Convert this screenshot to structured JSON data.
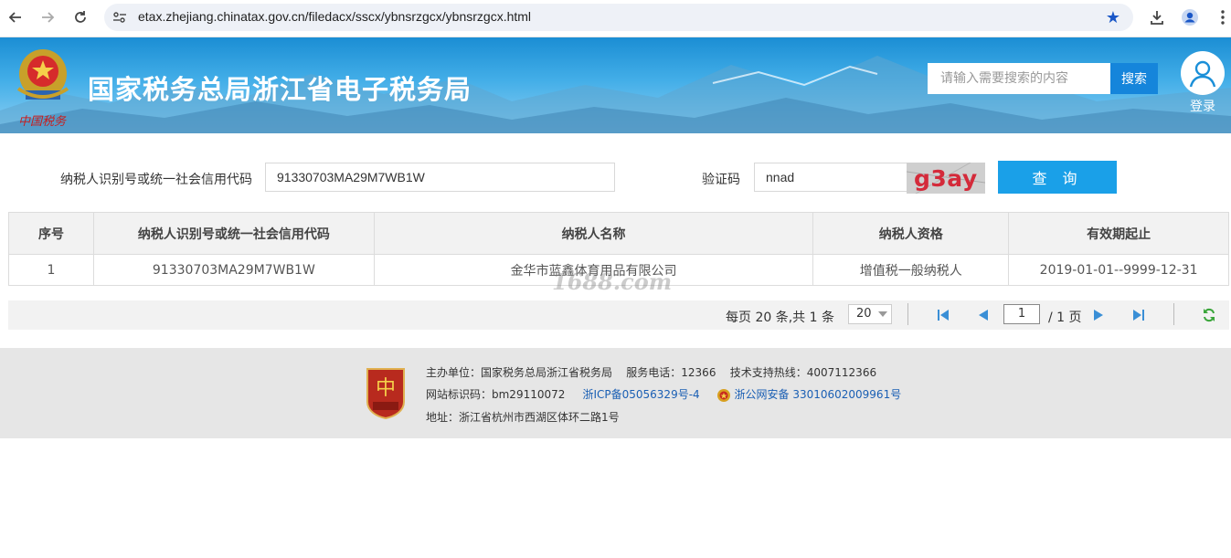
{
  "browser": {
    "url": "etax.zhejiang.chinatax.gov.cn/filedacx/sscx/ybnsrzgcx/ybnsrzgcx.html"
  },
  "header": {
    "site_title": "国家税务总局浙江省电子税务局",
    "search_placeholder": "请输入需要搜索的内容",
    "search_button": "搜索",
    "login_label": "登录"
  },
  "form": {
    "tax_id_label": "纳税人识别号或统一社会信用代码",
    "tax_id_value": "91330703MA29M7WB1W",
    "captcha_label": "验证码",
    "captcha_value": "nnad",
    "captcha_image_text": "g3ay",
    "query_button": "查 询"
  },
  "table": {
    "headers": [
      "序号",
      "纳税人识别号或统一社会信用代码",
      "纳税人名称",
      "纳税人资格",
      "有效期起止"
    ],
    "rows": [
      [
        "1",
        "91330703MA29M7WB1W",
        "金华市蓝鑫体育用品有限公司",
        "增值税一般纳税人",
        "2019-01-01--9999-12-31"
      ]
    ]
  },
  "watermark": "1688.com",
  "pager": {
    "info": "每页 20 条,共 1 条",
    "page_size": "20",
    "current_page": "1",
    "total_pages": "/ 1 页"
  },
  "footer": {
    "sponsor": "主办单位：国家税务总局浙江省税务局",
    "service_phone": "服务电话：12366",
    "support_hotline": "技术支持热线：4007112366",
    "site_id": "网站标识码：bm29110072",
    "icp": "浙ICP备05056329号-4",
    "police": "浙公网安备 33010602009961号",
    "address": "地址：浙江省杭州市西湖区体环二路1号"
  },
  "colors": {
    "brand_blue": "#1aa0e8",
    "search_blue": "#1585db",
    "captcha_red": "#d42a3a"
  }
}
